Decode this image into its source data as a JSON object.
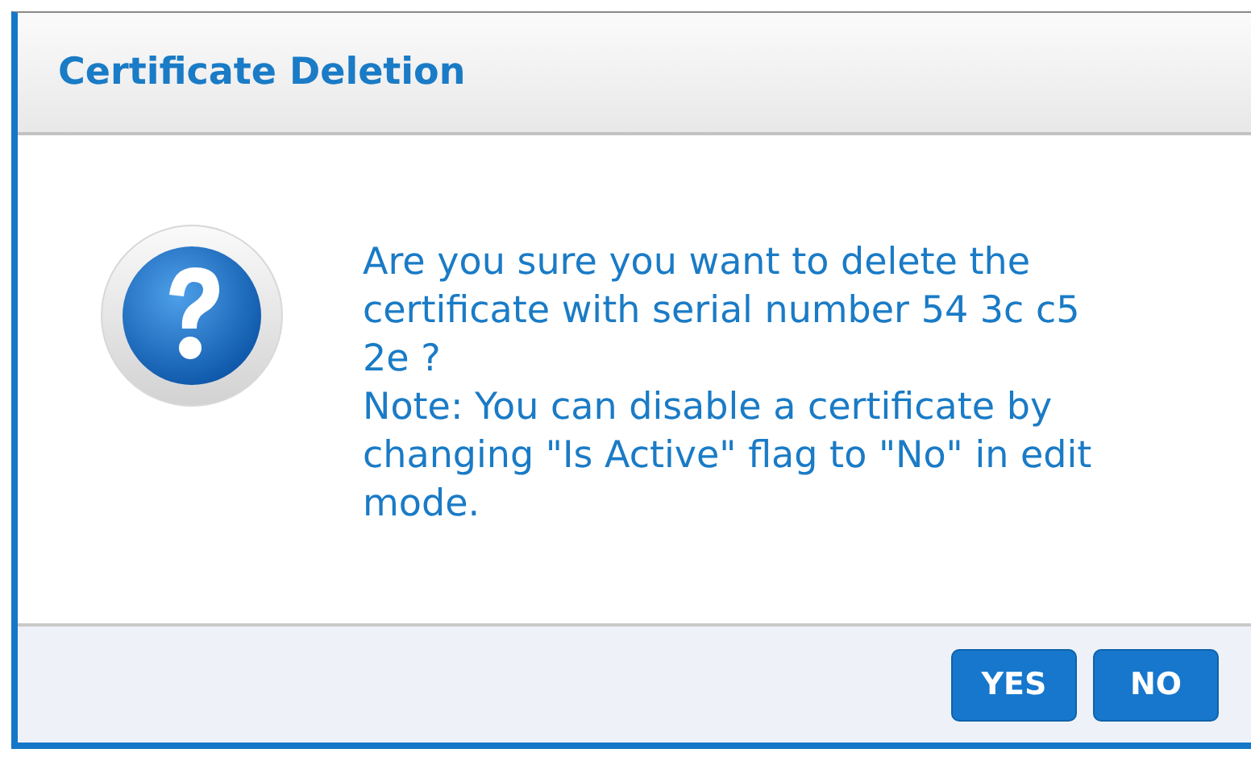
{
  "dialog": {
    "title": "Certificate Deletion",
    "message": [
      "Are you sure you want to delete the certificate with serial number 54 3c c5 2e ?",
      "Note: You can disable a certificate by changing \"Is Active\" flag to \"No\" in edit mode."
    ],
    "buttons": [
      "YES",
      "NO"
    ]
  }
}
